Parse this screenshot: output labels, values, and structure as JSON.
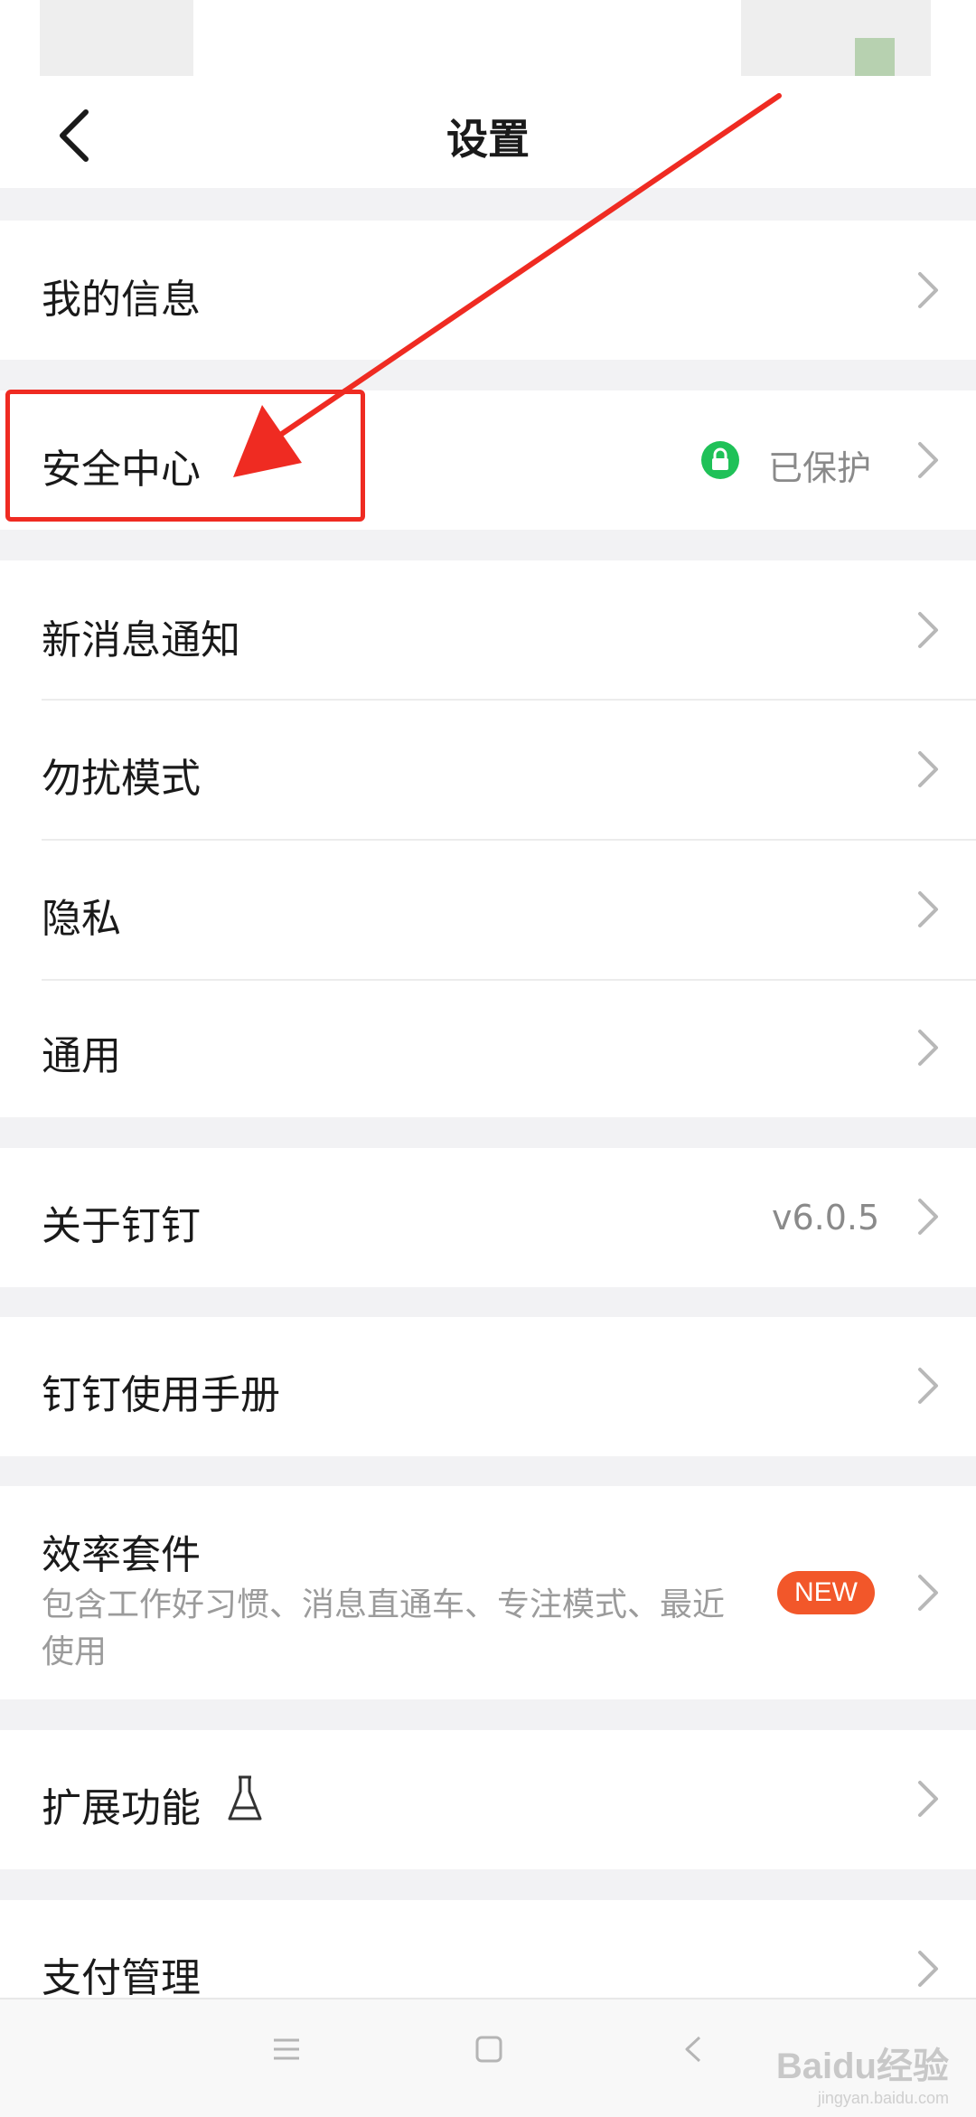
{
  "header": {
    "title": "设置"
  },
  "rows": {
    "my_info": "我的信息",
    "security_center": "安全中心",
    "security_status": "已保护",
    "new_message_notify": "新消息通知",
    "do_not_disturb": "勿扰模式",
    "privacy": "隐私",
    "general": "通用",
    "about": "关于钉钉",
    "about_version": "v6.0.5",
    "manual": "钉钉使用手册",
    "efficiency_suite": "效率套件",
    "efficiency_suite_desc": "包含工作好习惯、消息直通车、专注模式、最近使用",
    "efficiency_badge": "NEW",
    "extensions": "扩展功能",
    "payment": "支付管理"
  },
  "watermark": {
    "brand": "Baidu经验",
    "domain": "jingyan.baidu.com"
  },
  "colors": {
    "annotation_red": "#ef2b22",
    "secure_green": "#1fc158",
    "badge_orange": "#f2572a"
  },
  "icons": {
    "back": "back-arrow-icon",
    "chevron": "chevron-right-icon",
    "lock": "lock-icon",
    "flask": "flask-icon",
    "nav_menu": "menu-icon",
    "nav_home": "home-square-icon",
    "nav_back": "back-triangle-icon"
  }
}
